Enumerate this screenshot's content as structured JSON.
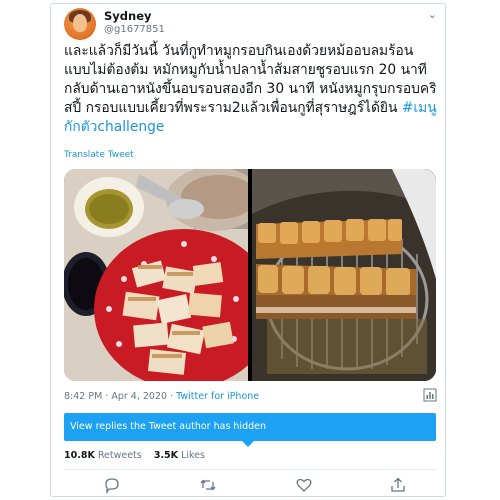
{
  "user": {
    "name": "Sydney",
    "handle": "@g1677851"
  },
  "tweet": {
    "text": "และแล้วก็มีวันนี้ วันที่กูทำหมูกรอบกินเองด้วยหม้ออบลมร้อน แบบไม่ต้องต้ม หมักหมูกับน้ำปลาน้ำส้มสายชูรอบแรก 20 นาที กลับด้านเอาหนังขึ้นอบรอบสองอีก 30 นาที หนังหมูกรุบกรอบคริสปี้ กรอบแบบเคี้ยวที่พระราม2แล้วเพื่อนกูที่สุราษฎร์ได้ยิน",
    "hashtag": "#เมนูกักตัวchallenge",
    "translate_label": "Translate Tweet"
  },
  "meta": {
    "timestamp": "8:42 PM · Apr 4, 2020 · ",
    "source": "Twitter for iPhone"
  },
  "hidden_replies_label": "View replies the Tweet author has hidden",
  "stats": {
    "retweets_count": "10.8K",
    "retweets_label": "Retweets",
    "likes_count": "3.5K",
    "likes_label": "Likes"
  },
  "colors": {
    "accent": "#1da1f2",
    "link": "#1b95e0",
    "text": "#14171a",
    "muted": "#657786"
  },
  "icons": [
    "chevron-down-icon",
    "analytics-icon",
    "reply-icon",
    "retweet-icon",
    "like-icon",
    "share-icon"
  ]
}
